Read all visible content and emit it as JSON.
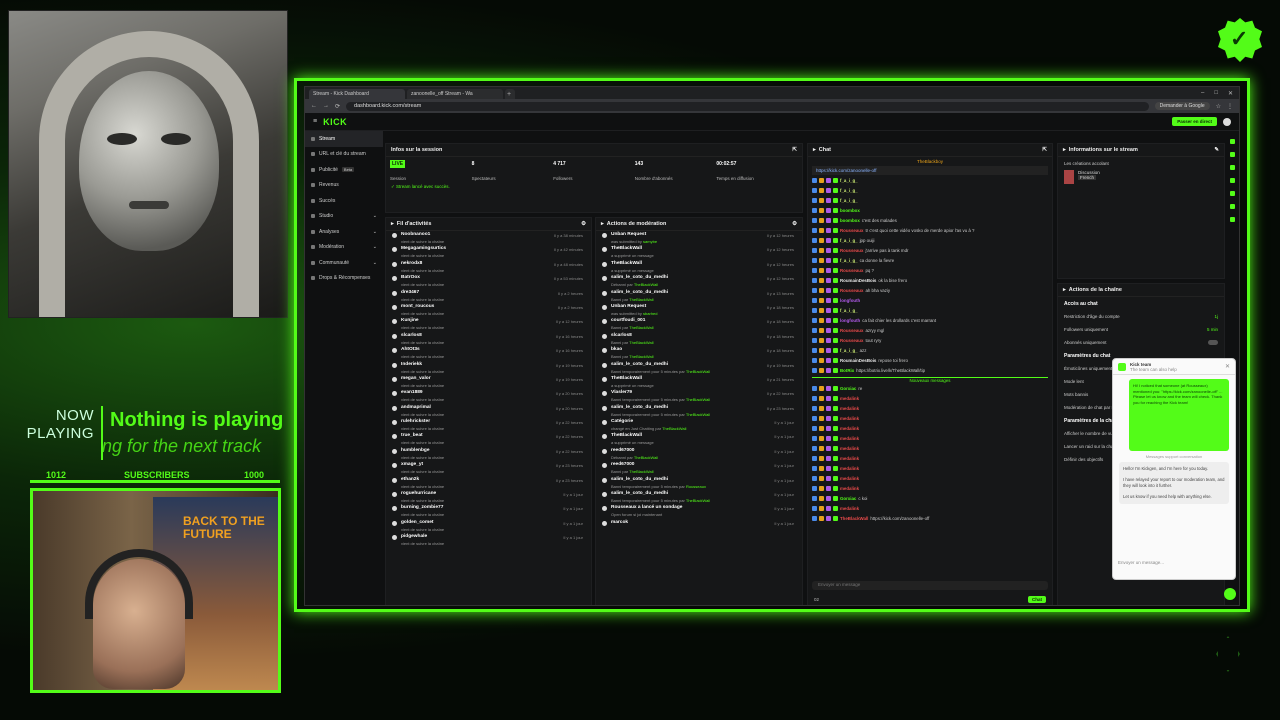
{
  "overlay": {
    "now_playing_label": "NOW PLAYING",
    "now_playing_title": "Nothing is playing",
    "now_playing_sub": "ng for the next track",
    "subs_current": "1012",
    "subs_label": "SUBSCRIBERS",
    "subs_goal": "1000",
    "subs_progress": 1.0,
    "poster_title": "BACK TO THE FUTURE",
    "accent": "#53fc18"
  },
  "browser": {
    "tabs": [
      "Stream - Kick Dashboard",
      "zanoonelle_off Stream - Wa"
    ],
    "url": "dashboard.kick.com/stream",
    "google_button": "Demander à Google"
  },
  "app": {
    "logo": "KICK",
    "go_live": "Passer en direct",
    "sidebar": [
      "Stream",
      "URL et clé du stream",
      "Publicité",
      "Revenus",
      "Succès",
      "Studio",
      "Analyses",
      "Modération",
      "Communauté",
      "Drops & Récompenses"
    ],
    "beta": "Beta"
  },
  "session": {
    "title": "Infos sur la session",
    "live": "LIVE",
    "session_label": "Session",
    "stats": [
      {
        "value": "8",
        "label": "Spectateurs"
      },
      {
        "value": "4 717",
        "label": "Followers"
      },
      {
        "value": "143",
        "label": "Nombre d'abonnés"
      },
      {
        "value": "00:02:57",
        "label": "Temps en diffusion"
      }
    ],
    "ok": "Stream lancé avec succès."
  },
  "activity": {
    "title": "Fil d'activités",
    "rows": [
      {
        "name": "Noobnanoo1",
        "sub": "vient de suivre la chaîne",
        "time": "Il y a 38 minutes"
      },
      {
        "name": "Megagamingsurtics",
        "sub": "vient de suivre la chaîne",
        "time": "Il y a 42 minutes"
      },
      {
        "name": "nekrodx8",
        "sub": "vient de suivre la chaîne",
        "time": "Il y a 48 minutes"
      },
      {
        "name": "BatrOox",
        "sub": "vient de suivre la chaîne",
        "time": "Il y a 53 minutes"
      },
      {
        "name": "dre3467",
        "sub": "vient de suivre la chaîne",
        "time": "Il y a 2 heures"
      },
      {
        "name": "mont_roucous",
        "sub": "vient de suivre la chaîne",
        "time": "Il y a 2 heures"
      },
      {
        "name": "Kunjine",
        "sub": "vient de suivre la chaîne",
        "time": "Il y a 12 heures"
      },
      {
        "name": "slcarlos8",
        "sub": "vient de suivre la chaîne",
        "time": "Il y a 16 heures"
      },
      {
        "name": "AhtOt3s",
        "sub": "vient de suivre la chaîne",
        "time": "Il y a 16 heures"
      },
      {
        "name": "Inderiekk",
        "sub": "vient de suivre la chaîne",
        "time": "Il y a 19 heures"
      },
      {
        "name": "megan_valor",
        "sub": "vient de suivre la chaîne",
        "time": "Il y a 19 heures"
      },
      {
        "name": "evan1889",
        "sub": "vient de suivre la chaîne",
        "time": "Il y a 20 heures"
      },
      {
        "name": "andmaprimal",
        "sub": "vient de suivre la chaîne",
        "time": "Il y a 20 heures"
      },
      {
        "name": "rulehrickster",
        "sub": "vient de suivre la chaîne",
        "time": "Il y a 22 heures"
      },
      {
        "name": "true_beat",
        "sub": "vient de suivre la chaîne",
        "time": "Il y a 22 heures"
      },
      {
        "name": "humblenbge",
        "sub": "vient de suivre la chaîne",
        "time": "Il y a 22 heures"
      },
      {
        "name": "xmage_yt",
        "sub": "vient de suivre la chaîne",
        "time": "Il y a 23 heures"
      },
      {
        "name": "ethan2k",
        "sub": "vient de suivre la chaîne",
        "time": "Il y a 23 heures"
      },
      {
        "name": "roguehurricane",
        "sub": "vient de suivre la chaîne",
        "time": "Il y a 1 jour"
      },
      {
        "name": "burning_zombie77",
        "sub": "vient de suivre la chaîne",
        "time": "Il y a 1 jour"
      },
      {
        "name": "golden_comet",
        "sub": "vient de suivre la chaîne",
        "time": "Il y a 1 jour"
      },
      {
        "name": "pidgewhale",
        "sub": "vient de suivre la chaîne",
        "time": "Il y a 1 jour"
      }
    ]
  },
  "moderation": {
    "title": "Actions de modération",
    "rows": [
      {
        "name": "Unban Request",
        "sub": "was submitted by",
        "who": "samybe",
        "time": "Il y a 12 heures"
      },
      {
        "name": "TheBlackWall",
        "sub": "a supprimé un message",
        "who": "",
        "time": "Il y a 12 heures"
      },
      {
        "name": "TheBlackWall",
        "sub": "a supprimé un message",
        "who": "",
        "time": "Il y a 12 heures"
      },
      {
        "name": "salim_le_coto_du_medhi",
        "sub": "Débanni par",
        "who": "TheBlackWall",
        "time": "Il y a 12 heures"
      },
      {
        "name": "salim_le_coto_du_medhi",
        "sub": "Banni par",
        "who": "TheBlackWall",
        "time": "Il y a 13 heures"
      },
      {
        "name": "Unban Request",
        "sub": "was submitted by",
        "who": "sbarhed",
        "time": "Il y a 18 heures"
      },
      {
        "name": "courtfoudi_001",
        "sub": "Banni par",
        "who": "TheBlackWall",
        "time": "Il y a 18 heures"
      },
      {
        "name": "slcarlos8",
        "sub": "Banni par",
        "who": "TheBlackWall",
        "time": "Il y a 18 heures"
      },
      {
        "name": "bkao",
        "sub": "Banni par",
        "who": "TheBlackWall",
        "time": "Il y a 18 heures"
      },
      {
        "name": "salim_le_coto_du_medhi",
        "sub": "Banni temporairement pour 5 minutes par",
        "who": "TheBlackWall",
        "time": "Il y a 19 heures"
      },
      {
        "name": "TheBlackWall",
        "sub": "a supprimé un message",
        "who": "",
        "time": "Il y a 21 heures"
      },
      {
        "name": "Vlasler79",
        "sub": "Banni temporairement pour 5 minutes par",
        "who": "TheBlackWall",
        "time": "Il y a 22 heures"
      },
      {
        "name": "salim_le_coto_du_medhi",
        "sub": "Banni temporairement pour 5 minutes par",
        "who": "TheBlackWall",
        "time": "Il y a 23 heures"
      },
      {
        "name": "Catégorie",
        "sub": "changé en Just Chatting par",
        "who": "TheBlackWall",
        "time": "Il y a 1 jour"
      },
      {
        "name": "TheBlackWall",
        "sub": "a supprimé un message",
        "who": "",
        "time": "Il y a 1 jour"
      },
      {
        "name": "reed67000",
        "sub": "Débanni par",
        "who": "TheBlackWall",
        "time": "Il y a 1 jour"
      },
      {
        "name": "reed67000",
        "sub": "Banni par",
        "who": "TheBlackWall",
        "time": "Il y a 1 jour"
      },
      {
        "name": "salim_le_coto_du_medhi",
        "sub": "Banni temporairement pour 5 minutes par",
        "who": "Rousseaux",
        "time": "Il y a 1 jour"
      },
      {
        "name": "salim_le_coto_du_medhi",
        "sub": "Banni temporairement pour 5 minutes par",
        "who": "TheBlackWall",
        "time": "Il y a 1 jour"
      },
      {
        "name": "Rousseaux a lancé un sondage",
        "sub": "Open forum si joi maintenant",
        "who": "",
        "time": "Il y a 1 jour"
      },
      {
        "name": "marcok",
        "sub": "",
        "who": "",
        "time": "Il y a 1 jour"
      }
    ]
  },
  "chat": {
    "title": "Chat",
    "pinned_user": "TheBlackboy",
    "pinned_link": "https://kick.com/zanoonelle-off",
    "lines": [
      {
        "user": "f_a_i_g_",
        "color": "#c8e870",
        "text": ""
      },
      {
        "user": "f_a_i_g_",
        "color": "#c8e870",
        "text": ""
      },
      {
        "user": "f_a_i_g_",
        "color": "#c8e870",
        "text": ""
      },
      {
        "user": "boombox",
        "color": "#53fc18",
        "text": ""
      },
      {
        "user": "boombox",
        "color": "#53fc18",
        "text": "c'est des malades"
      },
      {
        "user": "Rousseaux",
        "color": "#e84a4a",
        "text": "tr c'est quoi cette vidéo vosko de merde apior l'as vu à ?"
      },
      {
        "user": "f_a_i_g_",
        "color": "#c8e870",
        "text": "jpp ouiji"
      },
      {
        "user": "Rousseaux",
        "color": "#e84a4a",
        "text": "j'arrive pas à tank mdr"
      },
      {
        "user": "f_a_i_g_",
        "color": "#c8e870",
        "text": "ca donne la fievre"
      },
      {
        "user": "Rousseaux",
        "color": "#e84a4a",
        "text": "pq ?"
      },
      {
        "user": "RoumainDesBois",
        "color": "#e8e8e8",
        "text": "ok la bise frero"
      },
      {
        "user": "Rousseaux",
        "color": "#e84a4a",
        "text": "ah bha vaziy"
      },
      {
        "user": "longfouth",
        "color": "#b05ae8",
        "text": ""
      },
      {
        "user": "f_a_i_g_",
        "color": "#c8e870",
        "text": ""
      },
      {
        "user": "longfouth",
        "color": "#b05ae8",
        "text": "ca fait chier les drollards c'est marrant"
      },
      {
        "user": "Rousseaux",
        "color": "#e84a4a",
        "text": "azryy mgl"
      },
      {
        "user": "Rousseaux",
        "color": "#e84a4a",
        "text": "tout ryry"
      },
      {
        "user": "f_a_i_g_",
        "color": "#c8e870",
        "text": "azz"
      },
      {
        "user": "RoumainDesBois",
        "color": "#e8e8e8",
        "text": "repose toi frero"
      },
      {
        "user": "BotRix",
        "color": "#53fc18",
        "text": "https://botrix.live/k/TheBlackWall/tip"
      }
    ],
    "new_messages": "Nouveaux messages",
    "after": [
      {
        "user": "Gorxiac",
        "color": "#53fc18",
        "text": "re"
      },
      {
        "user": "medalink",
        "color": "#e84a4a",
        "text": ""
      },
      {
        "user": "medalink",
        "color": "#e84a4a",
        "text": ""
      },
      {
        "user": "medalink",
        "color": "#e84a4a",
        "text": ""
      },
      {
        "user": "medalink",
        "color": "#e84a4a",
        "text": ""
      },
      {
        "user": "medalink",
        "color": "#e84a4a",
        "text": ""
      },
      {
        "user": "medalink",
        "color": "#e84a4a",
        "text": ""
      },
      {
        "user": "medalink",
        "color": "#e84a4a",
        "text": ""
      },
      {
        "user": "medalink",
        "color": "#e84a4a",
        "text": ""
      },
      {
        "user": "medalink",
        "color": "#e84a4a",
        "text": ""
      },
      {
        "user": "medalink",
        "color": "#e84a4a",
        "text": ""
      },
      {
        "user": "Gorxiac",
        "color": "#53fc18",
        "text": "c koi"
      },
      {
        "user": "medalink",
        "color": "#e84a4a",
        "text": ""
      },
      {
        "user": "TheBlackWall",
        "color": "#e84a4a",
        "text": "https://kick.com/zanoonelle-off"
      }
    ],
    "input_placeholder": "Envoyer un message",
    "send": "Chat",
    "viewers_count": "02"
  },
  "info": {
    "title": "Informations sur le stream",
    "fields": [
      "Les créations accolant",
      "Discussion",
      "French"
    ]
  },
  "chain": {
    "title": "Actions de la chaîne",
    "access": "Accès au chat",
    "settings": [
      {
        "label": "Restriction d'âge du compte",
        "value": "1j"
      },
      {
        "label": "Followers uniquement",
        "value": "5 min"
      },
      {
        "label": "Abonnés uniquement",
        "value": ""
      }
    ],
    "chat_params": "Paramètres du chat",
    "chat_items": [
      "Émoticônes uniquement",
      "Mode lent",
      "Mots bannis",
      "Modération de chat par IA"
    ],
    "chain_params": "Paramètres de la chaîne",
    "chain_items": [
      "Afficher le nombre de vues",
      "Lancer un raid sur la chaîne",
      "Définir des objectifs"
    ]
  },
  "support": {
    "title": "Kick team",
    "subtitle": "The team can also help",
    "green_text": "Hi! I noticed that someone (at Rousseaux) mentioned you: \"https://kick.com/zanoonelle-off\" ... Please let us know and the team will check. Thank you for reaching the Kick team!",
    "note": "Messages support conversation",
    "msg1": "Hello! I'm Kickgen, and I'm here for you today.",
    "msg2": "I have relayed your report to our moderation team, and they will look into it further.",
    "msg3": "Let us know if you need help with anything else.",
    "input": "Envoyer un message..."
  }
}
